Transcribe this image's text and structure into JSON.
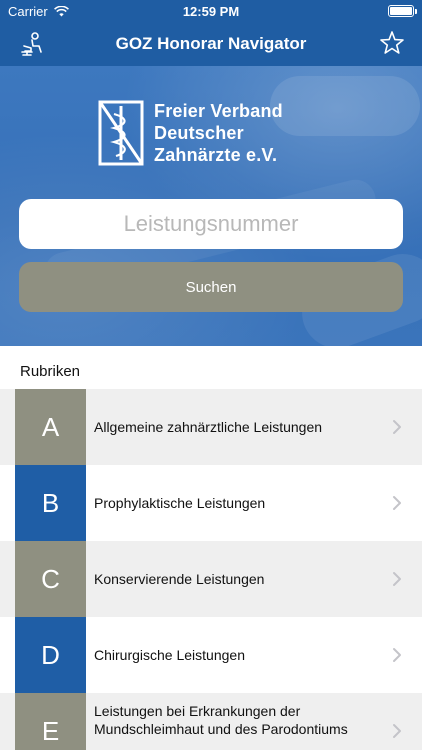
{
  "status": {
    "carrier": "Carrier",
    "time": "12:59 PM"
  },
  "nav": {
    "title": "GOZ Honorar Navigator"
  },
  "logo": {
    "line1": "Freier Verband",
    "line2": "Deutscher",
    "line3": "Zahnärzte e.V."
  },
  "search": {
    "placeholder": "Leistungsnummer",
    "value": "",
    "button_label": "Suchen"
  },
  "section": {
    "title": "Rubriken"
  },
  "rubriken": [
    {
      "letter": "A",
      "label": "Allgemeine zahnärztliche Leistungen",
      "color": "#8f9081"
    },
    {
      "letter": "B",
      "label": "Prophylaktische Leistungen",
      "color": "#1f5ea6"
    },
    {
      "letter": "C",
      "label": "Konservierende Leistungen",
      "color": "#8f9081"
    },
    {
      "letter": "D",
      "label": "Chirurgische Leistungen",
      "color": "#1f5ea6"
    },
    {
      "letter": "E",
      "label": "Leistungen bei Erkrankungen der Mundschleimhaut und des Parodontiums",
      "color": "#8f9081"
    }
  ],
  "colors": {
    "brand_blue": "#1f5da3",
    "accent_grey": "#8f9081"
  },
  "icons": {
    "left_nav": "dental-chair-icon",
    "right_nav": "star-icon",
    "row_arrow": "chevron-right-icon"
  }
}
